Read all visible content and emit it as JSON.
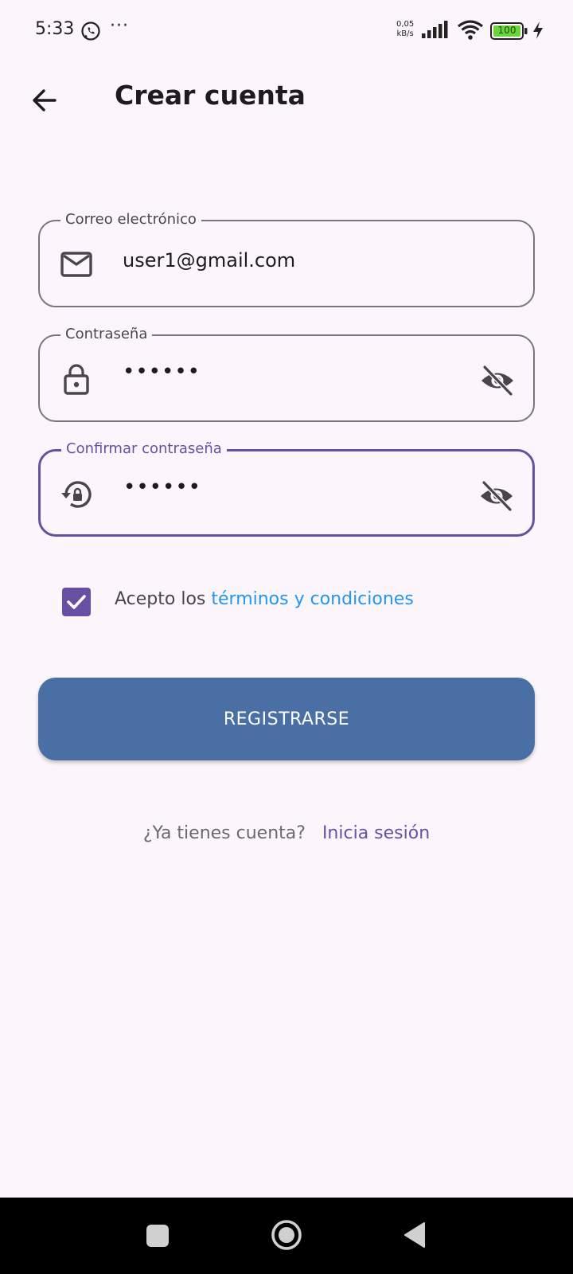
{
  "status_bar": {
    "time": "5:33",
    "more": "···",
    "net_speed_value": "0,05",
    "net_speed_unit": "kB/s",
    "battery_level": "100",
    "battery_color": "#6bd43a"
  },
  "app_bar": {
    "title": "Crear cuenta"
  },
  "form": {
    "email": {
      "label": "Correo electrónico",
      "value": "user1@gmail.com",
      "icon": "mail-icon"
    },
    "password": {
      "label": "Contraseña",
      "value": "••••••",
      "icon": "lock-icon",
      "toggle_icon": "visibility-off-icon"
    },
    "confirm_password": {
      "label": "Confirmar contraseña",
      "value": "••••••",
      "icon": "lock-reset-icon",
      "toggle_icon": "visibility-off-icon",
      "focused": true
    },
    "terms": {
      "checked": true,
      "prefix": "Acepto los ",
      "link": "términos y condiciones"
    },
    "register_button": "REGISTRARSE",
    "login_prompt": "¿Ya tienes cuenta?",
    "login_link": "Inicia sesión"
  },
  "colors": {
    "background": "#fcf6fc",
    "primary": "#6750a4",
    "button": "#4a6fa5",
    "link": "#2196f3"
  }
}
